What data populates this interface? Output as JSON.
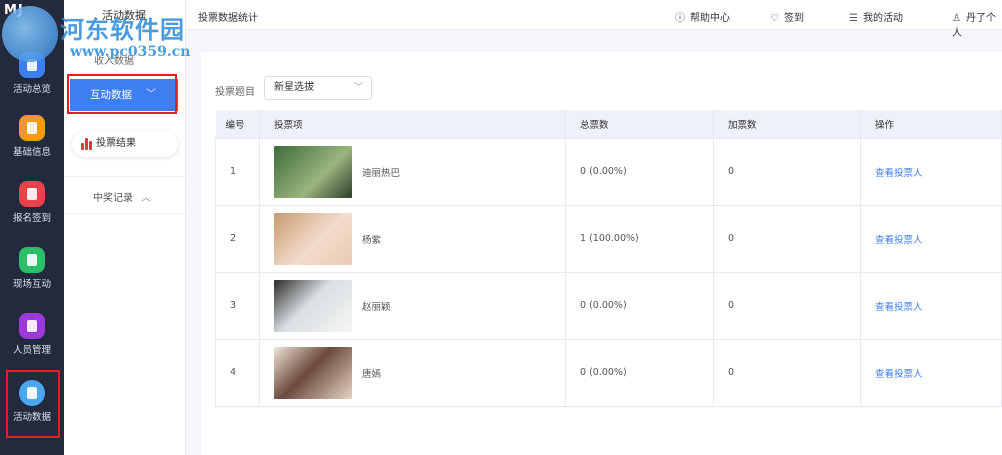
{
  "rail": {
    "logo": "MJ",
    "items": [
      {
        "label": "活动总览",
        "icon": "overview-icon",
        "color": "#3d7ef0"
      },
      {
        "label": "基础信息",
        "icon": "document-icon",
        "color": "#f29a1e"
      },
      {
        "label": "报名签到",
        "icon": "calendar-check-icon",
        "color": "#e8434a"
      },
      {
        "label": "现场互动",
        "icon": "interaction-icon",
        "color": "#2bbf6a"
      },
      {
        "label": "人员管理",
        "icon": "person-icon",
        "color": "#9b3ad8"
      },
      {
        "label": "活动数据",
        "icon": "bar-chart-icon",
        "color": "#4aa7f0"
      }
    ]
  },
  "sidebar": {
    "title": "活动数据",
    "sub_item": "收入数据",
    "active_item": "互动数据",
    "pill_item": "投票结果",
    "collapsed_item": "中奖记录"
  },
  "topbar": {
    "title": "投票数据统计",
    "help": "帮助中心",
    "signin": "签到",
    "my_activity": "我的活动",
    "user": "丹了个人"
  },
  "filter": {
    "label": "投票题目",
    "selected": "新星选拔"
  },
  "table": {
    "headers": [
      "编号",
      "投票项",
      "总票数",
      "加票数",
      "操作"
    ],
    "rows": [
      {
        "no": "1",
        "name": "迪丽热巴",
        "total": "0 (0.00%)",
        "extra": "0",
        "action": "查看投票人",
        "thumb_color": "#4a6a3a"
      },
      {
        "no": "2",
        "name": "杨紫",
        "total": "1 (100.00%)",
        "extra": "0",
        "action": "查看投票人",
        "thumb_color": "#e9c9b3"
      },
      {
        "no": "3",
        "name": "赵丽颖",
        "total": "0 (0.00%)",
        "extra": "0",
        "action": "查看投票人",
        "thumb_color": "#d9dfe2"
      },
      {
        "no": "4",
        "name": "唐嫣",
        "total": "0 (0.00%)",
        "extra": "0",
        "action": "查看投票人",
        "thumb_color": "#e8d4c4"
      }
    ]
  },
  "watermark": {
    "text": "河东软件园",
    "url": "www.pc0359.cn"
  },
  "colors": {
    "accent": "#3d7ef0",
    "highlight_border": "#e02020",
    "rail_bg": "#232a3d"
  }
}
